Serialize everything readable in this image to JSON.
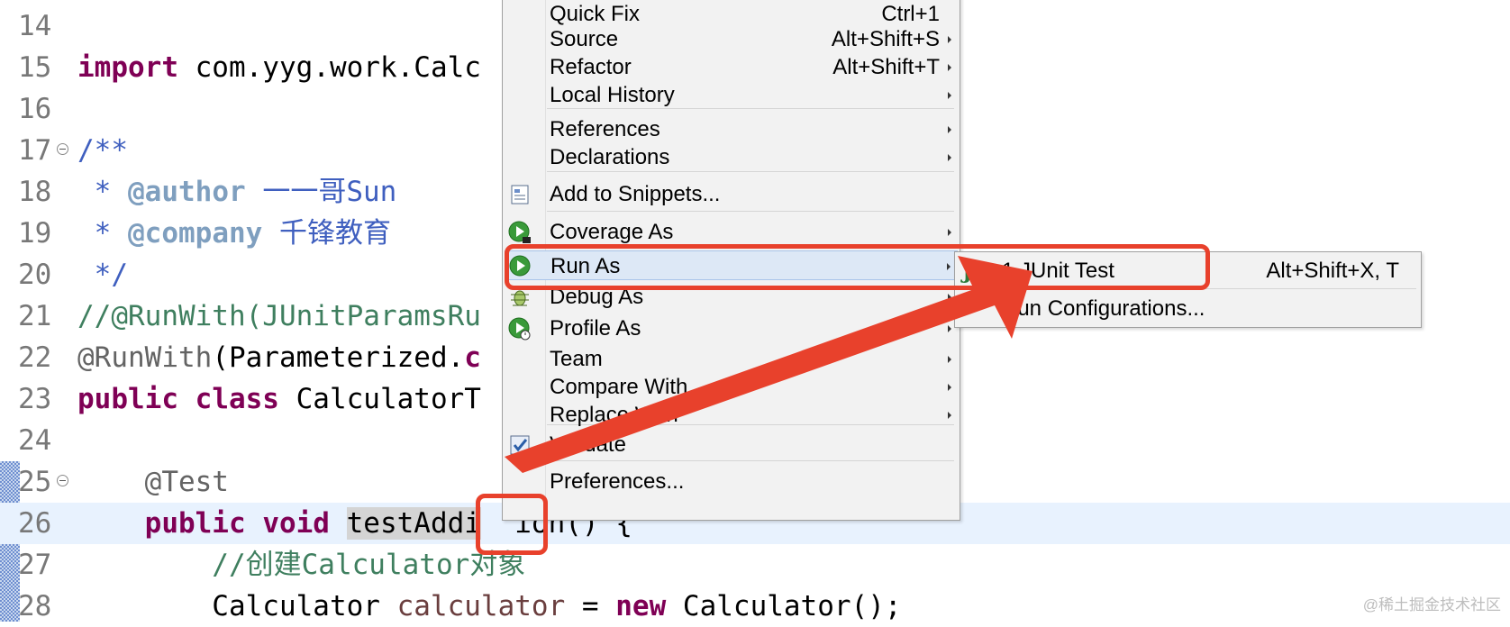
{
  "editor": {
    "lines": [
      {
        "no": "14",
        "segments": []
      },
      {
        "no": "15",
        "segments": [
          {
            "cls": "kw",
            "text": "import"
          },
          {
            "cls": "str",
            "text": " com.yyg.work.Calc"
          }
        ]
      },
      {
        "no": "16",
        "segments": []
      },
      {
        "no": "17",
        "fold": true,
        "segments": [
          {
            "cls": "jd",
            "text": "/**"
          }
        ]
      },
      {
        "no": "18",
        "segments": [
          {
            "cls": "jd",
            "text": " * "
          },
          {
            "cls": "jdtag",
            "text": "@author"
          },
          {
            "cls": "jd",
            "text": " 一一哥Sun"
          }
        ]
      },
      {
        "no": "19",
        "segments": [
          {
            "cls": "jd",
            "text": " * "
          },
          {
            "cls": "jdtag",
            "text": "@company"
          },
          {
            "cls": "jd",
            "text": " 千锋教育"
          }
        ]
      },
      {
        "no": "20",
        "segments": [
          {
            "cls": "jd",
            "text": " */"
          }
        ]
      },
      {
        "no": "21",
        "segments": [
          {
            "cls": "cm",
            "text": "//@RunWith(JUnitParamsRu"
          }
        ]
      },
      {
        "no": "22",
        "segments": [
          {
            "cls": "ann",
            "text": "@RunWith"
          },
          {
            "cls": "str",
            "text": "(Parameterized."
          },
          {
            "cls": "kw",
            "text": "c"
          }
        ]
      },
      {
        "no": "23",
        "segments": [
          {
            "cls": "kw",
            "text": "public"
          },
          {
            "cls": "str",
            "text": " "
          },
          {
            "cls": "kw",
            "text": "class"
          },
          {
            "cls": "str",
            "text": " CalculatorT"
          }
        ]
      },
      {
        "no": "24",
        "segments": []
      },
      {
        "no": "25",
        "fold": true,
        "segments": [
          {
            "cls": "ann",
            "text": "    @Test"
          }
        ]
      },
      {
        "no": "26",
        "current": true,
        "segments": [
          {
            "cls": "str",
            "text": "    "
          },
          {
            "cls": "kw",
            "text": "public"
          },
          {
            "cls": "str",
            "text": " "
          },
          {
            "cls": "kw",
            "text": "void"
          },
          {
            "cls": "str",
            "text": " "
          },
          {
            "cls": "sel",
            "text": "testAddi"
          },
          {
            "cls": "str",
            "text": "  ion() {"
          }
        ]
      },
      {
        "no": "27",
        "segments": [
          {
            "cls": "cm",
            "text": "        //创建Calculator对象"
          }
        ]
      },
      {
        "no": "28",
        "segments": [
          {
            "cls": "str",
            "text": "        Calculator "
          },
          {
            "cls": "fld",
            "text": "calculator"
          },
          {
            "cls": "str",
            "text": " = "
          },
          {
            "cls": "kw",
            "text": "new"
          },
          {
            "cls": "str",
            "text": " Calculator();"
          }
        ]
      }
    ]
  },
  "menu": {
    "items": [
      {
        "name": "quick-fix",
        "label": "Quick Fix",
        "shortcut": "Ctrl+1",
        "arrow": false,
        "icon": ""
      },
      {
        "name": "source",
        "label": "Source",
        "shortcut": "Alt+Shift+S",
        "arrow": true,
        "icon": ""
      },
      {
        "name": "refactor",
        "label": "Refactor",
        "shortcut": "Alt+Shift+T",
        "arrow": true,
        "icon": ""
      },
      {
        "name": "local-history",
        "label": "Local History",
        "shortcut": "",
        "arrow": true,
        "icon": ""
      },
      {
        "name": "references",
        "label": "References",
        "shortcut": "",
        "arrow": true,
        "icon": ""
      },
      {
        "name": "declarations",
        "label": "Declarations",
        "shortcut": "",
        "arrow": true,
        "icon": ""
      },
      {
        "name": "add-to-snippets",
        "label": "Add to Snippets...",
        "shortcut": "",
        "arrow": false,
        "icon": "snippets-icon"
      },
      {
        "name": "coverage-as",
        "label": "Coverage As",
        "shortcut": "",
        "arrow": true,
        "icon": "coverage-icon"
      },
      {
        "name": "run-as",
        "label": "Run As",
        "shortcut": "",
        "arrow": true,
        "icon": "run-icon",
        "highlighted": true
      },
      {
        "name": "debug-as",
        "label": "Debug As",
        "shortcut": "",
        "arrow": true,
        "icon": "debug-bug-icon"
      },
      {
        "name": "profile-as",
        "label": "Profile As",
        "shortcut": "",
        "arrow": true,
        "icon": "profile-icon"
      },
      {
        "name": "team",
        "label": "Team",
        "shortcut": "",
        "arrow": true,
        "icon": ""
      },
      {
        "name": "compare-with",
        "label": "Compare With",
        "shortcut": "",
        "arrow": true,
        "icon": ""
      },
      {
        "name": "replace-with",
        "label": "Replace With",
        "shortcut": "",
        "arrow": true,
        "icon": ""
      },
      {
        "name": "validate",
        "label": "Validate",
        "shortcut": "",
        "arrow": false,
        "icon": "validate-check-icon"
      },
      {
        "name": "preferences",
        "label": "Preferences...",
        "shortcut": "",
        "arrow": false,
        "icon": ""
      }
    ]
  },
  "submenu": {
    "items": [
      {
        "name": "junit-test",
        "label": "1 JUnit Test",
        "shortcut": "Alt+Shift+X, T",
        "icon": "junit-icon"
      },
      {
        "name": "run-configurations",
        "label": "Run Configurations...",
        "shortcut": "",
        "icon": ""
      }
    ]
  },
  "icons": {
    "junit_logo": "Jυ"
  },
  "annotation": {
    "color": "#e8412c"
  },
  "watermark": "@稀土掘金技术社区"
}
